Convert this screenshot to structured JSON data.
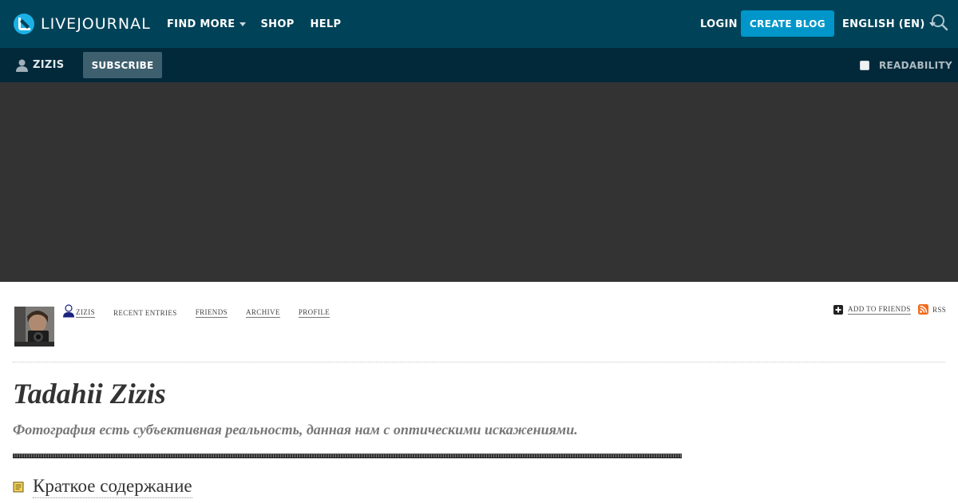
{
  "topbar": {
    "logo_text": "LIVEJOURNAL",
    "nav": {
      "find_more": "FIND MORE",
      "shop": "SHOP",
      "help": "HELP"
    },
    "login": "LOGIN",
    "create_blog": "CREATE BLOG",
    "language": "ENGLISH (EN)",
    "accent_color": "#0096c9",
    "bar_color": "#004359"
  },
  "subbar": {
    "username": "ZIZIS",
    "subscribe": "SUBSCRIBE",
    "readability": "READABILITY",
    "readability_checked": false
  },
  "journal": {
    "nav": {
      "user": "ZIZIS",
      "recent": "RECENT ENTRIES",
      "friends": "FRIENDS",
      "archive": "ARCHIVE",
      "profile": "PROFILE"
    },
    "add_to_friends": "ADD TO FRIENDS",
    "rss": "RSS",
    "title": "Tadahii Zizis",
    "subtitle": "Фотография есть субъективная реальность, данная нам с оптическими искажениями.",
    "summary_link": "Краткое содержание"
  },
  "icons": [
    "livejournal-logo-icon",
    "caret-down-icon",
    "search-icon",
    "user-icon",
    "checkbox-icon",
    "plus-icon",
    "rss-icon",
    "note-icon"
  ]
}
